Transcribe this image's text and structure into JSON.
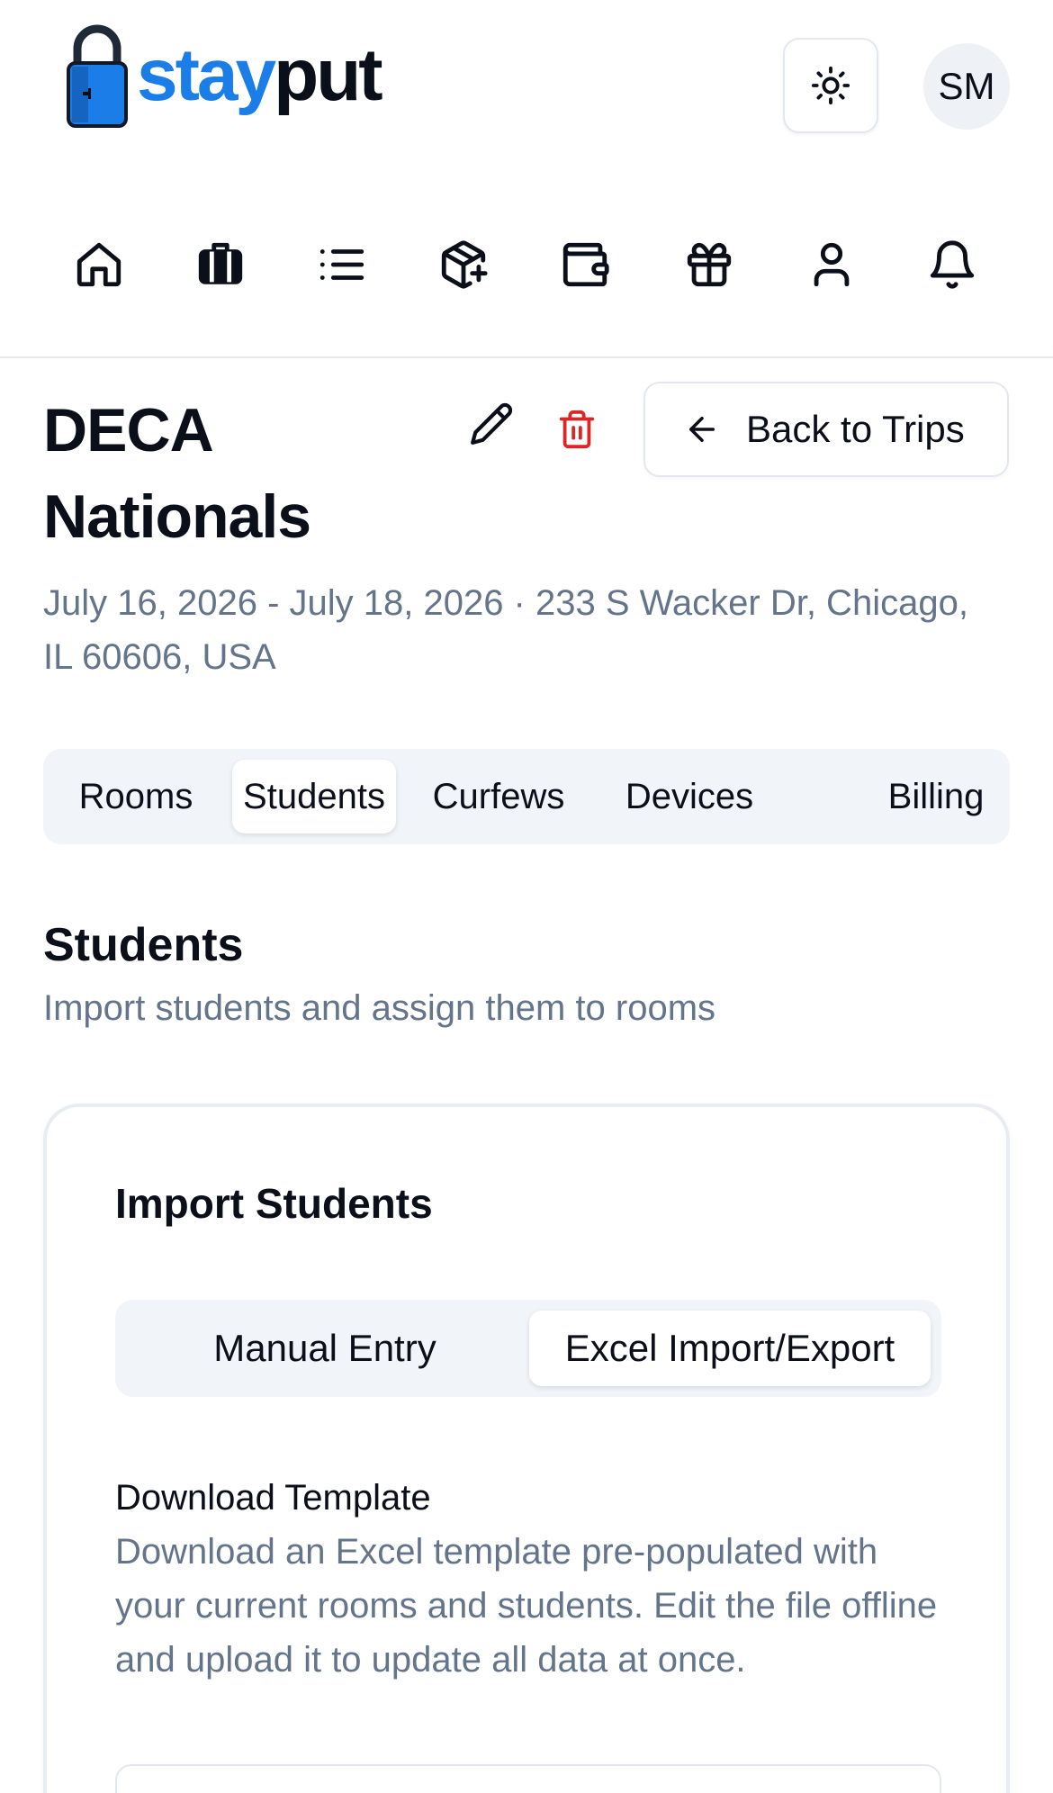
{
  "header": {
    "logo_stay": "stay",
    "logo_put": "put",
    "avatar_initials": "SM"
  },
  "nav_icons": [
    "home-icon",
    "luggage-icon",
    "list-icon",
    "package-plus-icon",
    "wallet-icon",
    "gift-icon",
    "user-icon",
    "bell-icon"
  ],
  "trip": {
    "title": "DECA Nationals",
    "subtitle": "July 16, 2026 - July 18, 2026 · 233 S Wacker Dr, Chicago, IL 60606, USA",
    "back_label": "Back to Trips"
  },
  "tabs": {
    "rooms": "Rooms",
    "students": "Students",
    "curfews": "Curfews",
    "devices": "Devices",
    "billing": "Billing"
  },
  "section": {
    "title": "Students",
    "subtitle": "Import students and assign them to rooms"
  },
  "import_card": {
    "title": "Import Students",
    "manual_tab": "Manual Entry",
    "excel_tab": "Excel Import/Export",
    "download_title": "Download Template",
    "download_desc": "Download an Excel template pre-populated with your current rooms and students. Edit the file offline and upload it to update all data at once."
  },
  "colors": {
    "brand_blue": "#1a7de8",
    "text_dark": "#0b0f19",
    "muted": "#64748b",
    "danger": "#dc2626"
  }
}
